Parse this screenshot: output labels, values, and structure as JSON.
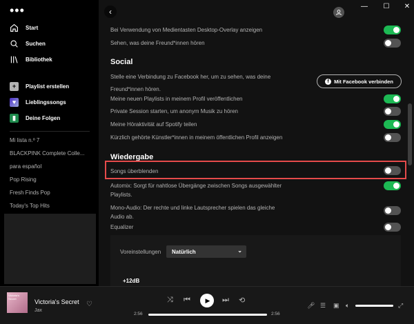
{
  "sidebar": {
    "nav": [
      {
        "label": "Start",
        "icon": "home-icon"
      },
      {
        "label": "Suchen",
        "icon": "search-icon"
      },
      {
        "label": "Bibliothek",
        "icon": "library-icon"
      }
    ],
    "library": [
      {
        "label": "Playlist erstellen",
        "icon": "plus-icon",
        "color": "#b3b3b3"
      },
      {
        "label": "Lieblingssongs",
        "icon": "heart-icon",
        "color": "#7a5ed6"
      },
      {
        "label": "Deine Folgen",
        "icon": "bookmark-icon",
        "color": "#1e8a4c"
      }
    ],
    "playlists": [
      "Mi lista n.º 7",
      "BLACKPINK Complete Colle...",
      "para español",
      "Pop Rising",
      "Fresh Finds Pop",
      "Today's Top Hits"
    ]
  },
  "settings": {
    "media_overlay": "Bei Verwendung von Medientasten Desktop-Overlay anzeigen",
    "friends_listening": "Sehen, was deine Freund*innen hören",
    "social_title": "Social",
    "facebook_text_1": "Stelle eine Verbindung zu Facebook her, um zu sehen, was deine",
    "facebook_text_2": "Freund*innen hören.",
    "facebook_button": "Mit Facebook verbinden",
    "new_playlists": "Meine neuen Playlists in meinem Profil veröffentlichen",
    "private_session": "Private Session starten, um anonym Musik zu hören",
    "share_activity": "Meine Höraktivität auf Spotify teilen",
    "recent_artists": "Kürzlich gehörte Künstler*innen in meinem öffentlichen Profil anzeigen",
    "playback_title": "Wiedergabe",
    "crossfade": "Songs überblenden",
    "automix_1": "Automix: Sorgt für nahtlose Übergänge zwischen Songs ausgewählter",
    "automix_2": "Playlists.",
    "mono_1": "Mono-Audio: Der rechte und linke Lautsprecher spielen das gleiche",
    "mono_2": "Audio ab.",
    "equalizer": "Equalizer",
    "presets_label": "Voreinstellungen",
    "preset_value": "Natürlich",
    "eq_db": "+12dB"
  },
  "player": {
    "cover_text": "Victoria's Secret",
    "title": "Victoria's Secret",
    "artist": "Jax",
    "time_elapsed": "2:56",
    "time_total": "2:56"
  },
  "colors": {
    "accent": "#1db954",
    "highlight": "#e64b4b"
  }
}
